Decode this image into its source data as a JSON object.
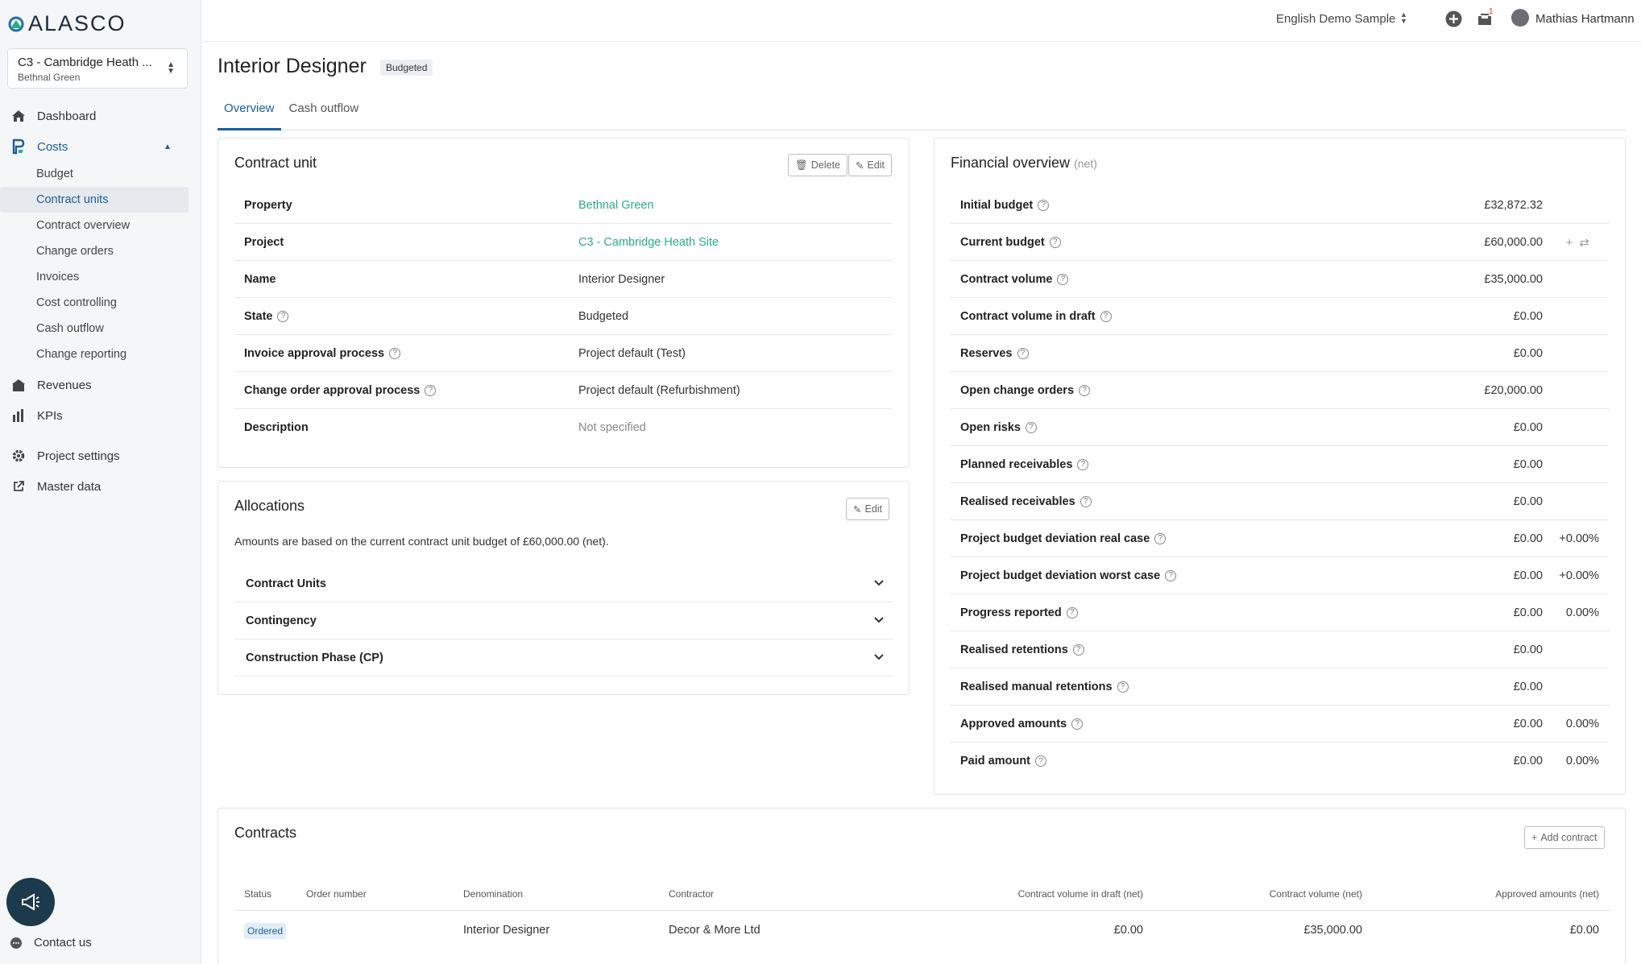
{
  "brand": {
    "name": "ALASCO"
  },
  "project_selector": {
    "project": "C3 - Cambridge Heath ...",
    "property": "Bethnal Green"
  },
  "sidebar": {
    "dashboard": "Dashboard",
    "costs": "Costs",
    "costs_items": [
      "Budget",
      "Contract units",
      "Contract overview",
      "Change orders",
      "Invoices",
      "Cost controlling",
      "Cash outflow",
      "Change reporting"
    ],
    "revenues": "Revenues",
    "kpis": "KPIs",
    "project_settings": "Project settings",
    "master_data": "Master data",
    "contact_us": "Contact us"
  },
  "topbar": {
    "organization": "English Demo Sample",
    "notification_count": "1",
    "user_name": "Mathias Hartmann"
  },
  "header": {
    "title": "Interior Designer",
    "badge": "Budgeted",
    "tabs": [
      "Overview",
      "Cash outflow"
    ]
  },
  "contract_unit": {
    "title": "Contract unit",
    "delete_label": "Delete",
    "edit_label": "Edit",
    "rows": [
      {
        "label": "Property",
        "value": "Bethnal Green"
      },
      {
        "label": "Project",
        "value": "C3 - Cambridge Heath Site"
      },
      {
        "label": "Name",
        "value": "Interior Designer"
      },
      {
        "label": "State",
        "value": "Budgeted"
      },
      {
        "label": "Invoice approval process",
        "value": "Project default (Test)"
      },
      {
        "label": "Change order approval process",
        "value": "Project default (Refurbishment)"
      },
      {
        "label": "Description",
        "value": "Not specified"
      }
    ]
  },
  "allocations": {
    "title": "Allocations",
    "edit_label": "Edit",
    "note": "Amounts are based on the current contract unit budget of £60,000.00 (net).",
    "items": [
      "Contract Units",
      "Contingency",
      "Construction Phase (CP)"
    ]
  },
  "financial": {
    "title": "Financial overview",
    "subtitle": "(net)",
    "rows": [
      {
        "label": "Initial budget",
        "amount": "£32,872.32",
        "pct": ""
      },
      {
        "label": "Current budget",
        "amount": "£60,000.00",
        "pct": ""
      },
      {
        "label": "Contract volume",
        "amount": "£35,000.00",
        "pct": ""
      },
      {
        "label": "Contract volume in draft",
        "amount": "£0.00",
        "pct": ""
      },
      {
        "label": "Reserves",
        "amount": "£0.00",
        "pct": ""
      },
      {
        "label": "Open change orders",
        "amount": "£20,000.00",
        "pct": ""
      },
      {
        "label": "Open risks",
        "amount": "£0.00",
        "pct": ""
      },
      {
        "label": "Planned receivables",
        "amount": "£0.00",
        "pct": ""
      },
      {
        "label": "Realised receivables",
        "amount": "£0.00",
        "pct": ""
      },
      {
        "label": "Project budget deviation real case",
        "amount": "£0.00",
        "pct": "+0.00%"
      },
      {
        "label": "Project budget deviation worst case",
        "amount": "£0.00",
        "pct": "+0.00%"
      },
      {
        "label": "Progress reported",
        "amount": "£0.00",
        "pct": "0.00%"
      },
      {
        "label": "Realised retentions",
        "amount": "£0.00",
        "pct": ""
      },
      {
        "label": "Realised manual retentions",
        "amount": "£0.00",
        "pct": ""
      },
      {
        "label": "Approved amounts",
        "amount": "£0.00",
        "pct": "0.00%"
      },
      {
        "label": "Paid amount",
        "amount": "£0.00",
        "pct": "0.00%"
      }
    ]
  },
  "contracts": {
    "title": "Contracts",
    "add_label": "Add contract",
    "columns": [
      "Status",
      "Order number",
      "Denomination",
      "Contractor",
      "Contract volume in draft (net)",
      "Contract volume (net)",
      "Approved amounts (net)"
    ],
    "rows": [
      {
        "status": "Ordered",
        "order_number": "",
        "denomination": "Interior Designer",
        "contractor": "Decor & More Ltd",
        "volume_draft": "£0.00",
        "volume": "£35,000.00",
        "approved": "£0.00"
      }
    ]
  }
}
